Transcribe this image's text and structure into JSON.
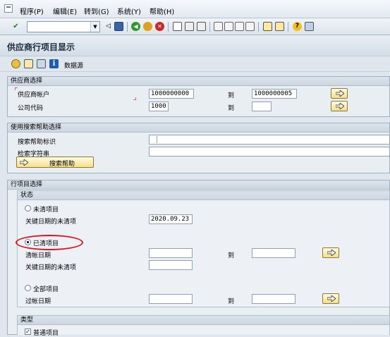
{
  "menu": [
    "程序(P)",
    "编辑(E)",
    "转到(G)",
    "系统(Y)",
    "帮助(H)"
  ],
  "toolbar": {
    "command_value": ""
  },
  "title": "供应商行项目显示",
  "app_toolbar": {
    "data_source": "数据源"
  },
  "vendor_selection": {
    "title": "供应商选择",
    "account_label": "供应商帐户",
    "account_from": "1000000000",
    "to_label": "到",
    "account_to": "1000000005",
    "company_label": "公司代码",
    "company_from": "1000",
    "company_to": ""
  },
  "search_help": {
    "title": "使用搜索帮助选择",
    "id_label": "搜索帮助标识",
    "string_label": "检索字符串",
    "button_label": "搜索帮助",
    "id_value": "",
    "string_value": ""
  },
  "line_item_selection": {
    "title": "行项目选择",
    "status_title": "状态",
    "open_items_label": "未清项目",
    "open_key_date_label": "关键日期的未清项",
    "open_key_date_value": "2020.09.23",
    "cleared_items_label": "已清项目",
    "clearing_date_label": "清帐日期",
    "cleared_key_date_label": "关键日期的未清项",
    "all_items_label": "全部项目",
    "posting_date_label": "过帐日期",
    "to_label": "到",
    "selected_status": "cleared"
  },
  "type": {
    "title": "类型",
    "normal_items_label": "普通项目",
    "normal_items_checked": true
  }
}
